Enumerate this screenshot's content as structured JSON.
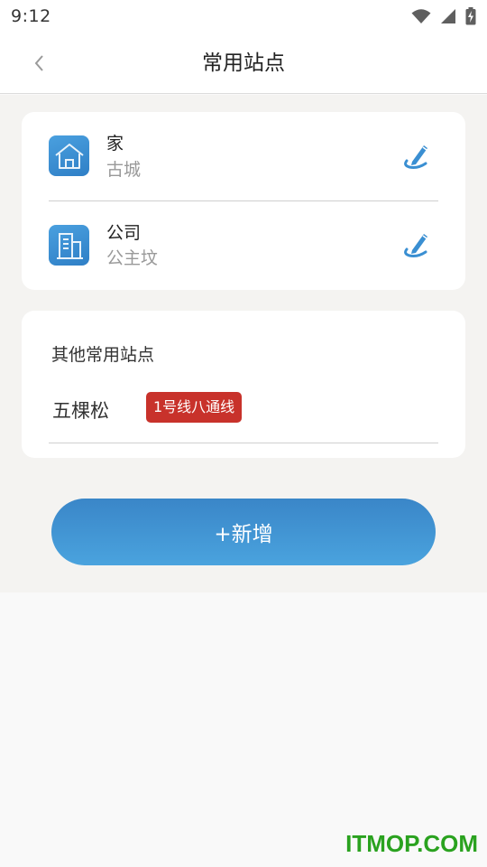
{
  "status_bar": {
    "time": "9:12",
    "icons": [
      "wifi-icon",
      "cellular-signal-icon",
      "battery-charging-icon"
    ]
  },
  "nav": {
    "back_icon": "chevron-left-icon",
    "title": "常用站点"
  },
  "favorites": [
    {
      "label": "家",
      "station": "古城",
      "icon": "home-icon",
      "action_icon": "edit-pen-icon"
    },
    {
      "label": "公司",
      "station": "公主坟",
      "icon": "building-icon",
      "action_icon": "edit-pen-icon"
    }
  ],
  "other": {
    "title": "其他常用站点",
    "stations": [
      {
        "name": "五棵松",
        "line": "1号线八通线"
      }
    ]
  },
  "add_button": {
    "label": "+新增"
  },
  "watermark": "ITMOP.COM",
  "colors": {
    "accent_blue": "#3a8fd2",
    "line_badge_red": "#c8322b",
    "page_bg": "#f4f3f1",
    "watermark_green": "#2aa21f"
  }
}
